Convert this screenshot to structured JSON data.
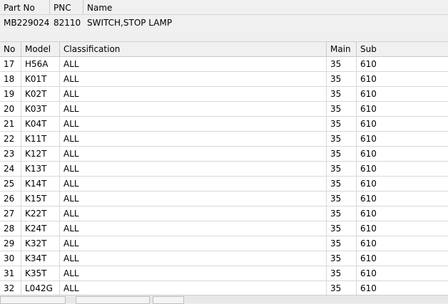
{
  "part_header": {
    "columns": [
      "Part No",
      "PNC",
      "Name"
    ],
    "part_no": "MB229024",
    "pnc": "82110",
    "name": "SWITCH,STOP LAMP"
  },
  "table": {
    "columns": [
      "No",
      "Model",
      "Classification",
      "Main",
      "Sub"
    ],
    "rows": [
      {
        "no": "17",
        "model": "H56A",
        "classification": "ALL",
        "main": "35",
        "sub": "610"
      },
      {
        "no": "18",
        "model": "K01T",
        "classification": "ALL",
        "main": "35",
        "sub": "610"
      },
      {
        "no": "19",
        "model": "K02T",
        "classification": "ALL",
        "main": "35",
        "sub": "610"
      },
      {
        "no": "20",
        "model": "K03T",
        "classification": "ALL",
        "main": "35",
        "sub": "610"
      },
      {
        "no": "21",
        "model": "K04T",
        "classification": "ALL",
        "main": "35",
        "sub": "610"
      },
      {
        "no": "22",
        "model": "K11T",
        "classification": "ALL",
        "main": "35",
        "sub": "610"
      },
      {
        "no": "23",
        "model": "K12T",
        "classification": "ALL",
        "main": "35",
        "sub": "610"
      },
      {
        "no": "24",
        "model": "K13T",
        "classification": "ALL",
        "main": "35",
        "sub": "610"
      },
      {
        "no": "25",
        "model": "K14T",
        "classification": "ALL",
        "main": "35",
        "sub": "610"
      },
      {
        "no": "26",
        "model": "K15T",
        "classification": "ALL",
        "main": "35",
        "sub": "610"
      },
      {
        "no": "27",
        "model": "K22T",
        "classification": "ALL",
        "main": "35",
        "sub": "610"
      },
      {
        "no": "28",
        "model": "K24T",
        "classification": "ALL",
        "main": "35",
        "sub": "610"
      },
      {
        "no": "29",
        "model": "K32T",
        "classification": "ALL",
        "main": "35",
        "sub": "610"
      },
      {
        "no": "30",
        "model": "K34T",
        "classification": "ALL",
        "main": "35",
        "sub": "610"
      },
      {
        "no": "31",
        "model": "K35T",
        "classification": "ALL",
        "main": "35",
        "sub": "610"
      },
      {
        "no": "32",
        "model": "L042G",
        "classification": "ALL",
        "main": "35",
        "sub": "610"
      }
    ]
  }
}
